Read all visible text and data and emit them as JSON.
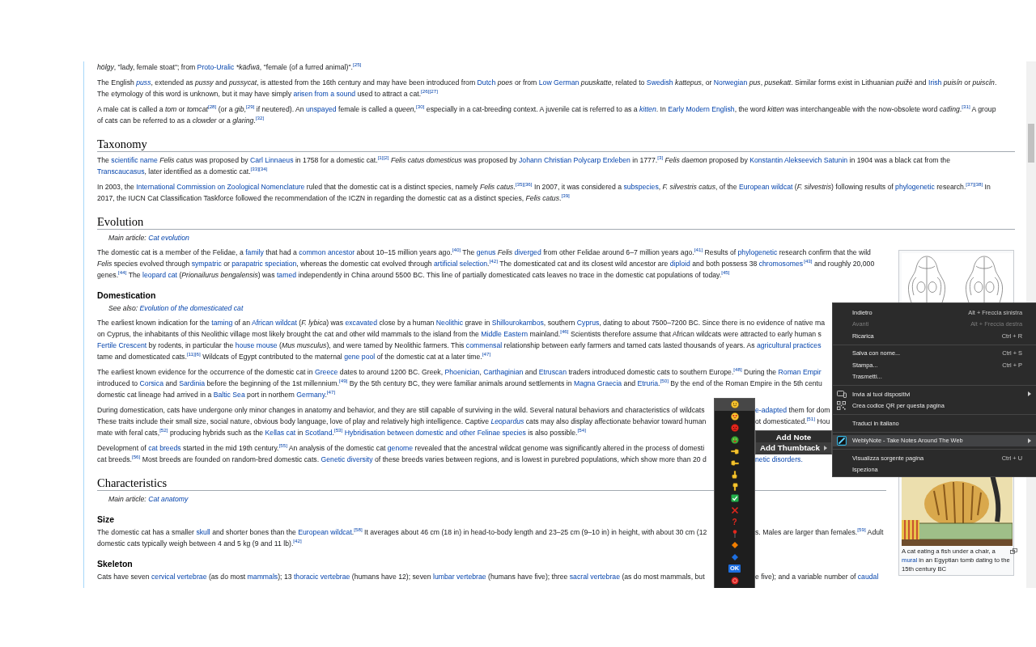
{
  "article": {
    "upper": [
      {
        "kind": "paragraph",
        "lines": [
          {
            "runs": [
              "*hölgy*, \"lady, female stoat\"; from ",
              {
                "link": "Proto-Uralic"
              },
              {
                "italic_text": " *käďwä"
              },
              ", \"female (of a furred animal)\".",
              {
                "ref": "[25]"
              }
            ]
          }
        ]
      },
      {
        "kind": "paragraph",
        "lines": [
          {
            "runs": [
              "The English ",
              {
                "link": "puss",
                "italic": true
              },
              ", extended as *pussy* and *pussycat*, is attested from the 16th century and may have been introduced from ",
              {
                "link": "Dutch"
              },
              " *poes* or from ",
              {
                "link": "Low German"
              },
              " *puuskatte*, related to ",
              {
                "link": "Swedish"
              },
              " *kattepus*, or ",
              {
                "link": "Norwegian"
              },
              " *pus*, *pusekatt*. Similar forms exist in Lithuanian *puižė* and ",
              {
                "link": "Irish"
              },
              " *puisín* or *puiscín*."
            ]
          },
          {
            "runs": [
              "The etymology of this word is unknown, but it may have simply ",
              {
                "link": "arisen from a sound"
              },
              " used to attract a cat.",
              {
                "ref": "[26][27]"
              }
            ]
          }
        ]
      },
      {
        "kind": "paragraph",
        "lines": [
          {
            "runs": [
              "A male cat is called a *tom* or *tomcat*",
              {
                "ref": "[28]"
              },
              " (or a *gib*,",
              {
                "ref": "[29]"
              },
              " if neutered). An ",
              {
                "link": "unspayed"
              },
              " female is called a *queen*,",
              {
                "ref": "[30]"
              },
              " especially in a cat-breeding context. A juvenile cat is referred to as a ",
              {
                "link": "kitten",
                "italic": true
              },
              ". In ",
              {
                "link": "Early Modern English"
              },
              ", the word *kitten* was interchangeable with the now-obsolete word *catling*.",
              {
                "ref": "[31]"
              },
              " A group"
            ]
          },
          {
            "runs": [
              "of cats can be referred to as a *clowder* or a *glaring*.",
              {
                "ref": "[32]"
              }
            ]
          }
        ]
      },
      {
        "kind": "heading",
        "text": "Taxonomy"
      },
      {
        "kind": "paragraph",
        "lines": [
          {
            "runs": [
              "The ",
              {
                "link": "scientific name"
              },
              " *Felis catus* was proposed by ",
              {
                "link": "Carl Linnaeus"
              },
              " in 1758 for a domestic cat.",
              {
                "ref": "[1][2]"
              },
              " *Felis catus domesticus* was proposed by ",
              {
                "link": "Johann Christian Polycarp Erxleben"
              },
              " in 1777.",
              {
                "ref": "[3]"
              },
              " *Felis daemon* proposed by ",
              {
                "link": "Konstantin Alekseevich Satunin"
              },
              " in 1904 was a black cat from the"
            ]
          },
          {
            "runs": [
              {
                "link": "Transcaucasus"
              },
              ", later identified as a domestic cat.",
              {
                "ref": "[33][34]"
              }
            ]
          }
        ]
      },
      {
        "kind": "paragraph",
        "lines": [
          {
            "runs": [
              "In 2003, the ",
              {
                "link": "International Commission on Zoological Nomenclature"
              },
              " ruled that the domestic cat is a distinct species, namely *Felis catus*.",
              {
                "ref": "[35][36]"
              },
              " In 2007, it was considered a ",
              {
                "link": "subspecies"
              },
              ", *F. silvestris catus*, of the ",
              {
                "link": "European wildcat"
              },
              " (*F. silvestris*) following results of ",
              {
                "link": "phylogenetic"
              },
              " research.",
              {
                "ref": "[37][38]"
              },
              " In"
            ]
          },
          {
            "runs": [
              "2017, the IUCN Cat Classification Taskforce followed the recommendation of the ICZN in regarding the domestic cat as a distinct species, *Felis catus*.",
              {
                "ref": "[39]"
              }
            ]
          }
        ]
      },
      {
        "kind": "heading",
        "text": "Evolution"
      },
      {
        "kind": "hatnote",
        "runs": [
          "Main article: ",
          {
            "link": "Cat evolution"
          }
        ]
      }
    ],
    "lower": {
      "blocks": [
        {
          "kind": "paragraph",
          "lines": [
            {
              "runs": [
                "The domestic cat is a member of the Felidae, a ",
                {
                  "link": "family"
                },
                " that had a ",
                {
                  "link": "common ancestor"
                },
                " about 10–15 million years ago.",
                {
                  "ref": "[40]"
                },
                " The ",
                {
                  "link": "genus"
                },
                " *Felis* ",
                {
                  "link": "diverged"
                },
                " from other Felidae around 6–7 million years ago.",
                {
                  "ref": "[41]"
                },
                " Results of ",
                {
                  "link": "phylogenetic"
                },
                " research confirm that the wild"
              ]
            },
            {
              "runs": [
                "*Felis* species evolved through ",
                {
                  "link": "sympatric"
                },
                " or ",
                {
                  "link": "parapatric speciation"
                },
                ", whereas the domestic cat evolved through ",
                {
                  "link": "artificial selection"
                },
                ".",
                {
                  "ref": "[42]"
                },
                " The domesticated cat and its closest wild ancestor are ",
                {
                  "link": "diploid"
                },
                " and both possess 38 ",
                {
                  "link": "chromosomes"
                },
                {
                  "ref": "[43]"
                },
                " and roughly 20,000"
              ]
            },
            {
              "runs": [
                "genes.",
                {
                  "ref": "[44]"
                },
                " The ",
                {
                  "link": "leopard cat"
                },
                " (*Prionailurus bengalensis*) was ",
                {
                  "link": "tamed"
                },
                " independently in China around 5500 BC. This line of partially domesticated cats leaves no trace in the domestic cat populations of today.",
                {
                  "ref": "[45]"
                }
              ]
            }
          ]
        },
        {
          "kind": "subheading",
          "text": "Domestication"
        },
        {
          "kind": "hatnote",
          "runs": [
            "See also: ",
            {
              "link": "Evolution of the domesticated cat"
            }
          ]
        },
        {
          "kind": "paragraph",
          "lines": [
            {
              "runs": [
                "The earliest known indication for the ",
                {
                  "link": "taming"
                },
                " of an ",
                {
                  "link": "African wildcat"
                },
                " (*F. lybica*) was ",
                {
                  "link": "excavated"
                },
                " close by a human ",
                {
                  "link": "Neolithic"
                },
                " grave in ",
                {
                  "link": "Shillourokambos"
                },
                ", southern ",
                {
                  "link": "Cyprus"
                },
                ", dating to about 7500–7200 BC. Since there is no evidence of native ma"
              ]
            },
            {
              "runs": [
                "on Cyprus, the inhabitants of this Neolithic village most likely brought the cat and other wild mammals to the island from the ",
                {
                  "link": "Middle Eastern"
                },
                " mainland.",
                {
                  "ref": "[46]"
                },
                " Scientists therefore assume that African wildcats were attracted to early human s"
              ]
            },
            {
              "runs": [
                {
                  "link": "Fertile Crescent"
                },
                " by rodents, in particular the ",
                {
                  "link": "house mouse"
                },
                " (*Mus musculus*), and were tamed by Neolithic farmers. This ",
                {
                  "link": "commensal"
                },
                " relationship between early farmers and tamed cats lasted thousands of years. As ",
                {
                  "link": "agricultural practices"
                }
              ]
            },
            {
              "runs": [
                "tame and domesticated cats.",
                {
                  "ref": "[11][6]"
                },
                " Wildcats of Egypt contributed to the maternal ",
                {
                  "link": "gene pool"
                },
                " of the domestic cat at a later time.",
                {
                  "ref": "[47]"
                }
              ]
            }
          ]
        },
        {
          "kind": "paragraph",
          "lines": [
            {
              "runs": [
                "The earliest known evidence for the occurrence of the domestic cat in ",
                {
                  "link": "Greece"
                },
                " dates to around 1200 BC. Greek, ",
                {
                  "link": "Phoenician"
                },
                ", ",
                {
                  "link": "Carthaginian"
                },
                " and ",
                {
                  "link": "Etruscan"
                },
                " traders introduced domestic cats to southern Europe.",
                {
                  "ref": "[48]"
                },
                " During the ",
                {
                  "link": "Roman Empir"
                }
              ]
            },
            {
              "runs": [
                "introduced to ",
                {
                  "link": "Corsica"
                },
                " and ",
                {
                  "link": "Sardinia"
                },
                " before the beginning of the 1st millennium.",
                {
                  "ref": "[49]"
                },
                " By the 5th century BC, they were familiar animals around settlements in ",
                {
                  "link": "Magna Graecia"
                },
                " and ",
                {
                  "link": "Etruria"
                },
                ".",
                {
                  "ref": "[50]"
                },
                " By the end of the Roman Empire in the 5th centu"
              ]
            },
            {
              "runs": [
                "domestic cat lineage had arrived in a ",
                {
                  "link": "Baltic Sea"
                },
                " port in northern ",
                {
                  "link": "Germany"
                },
                ".",
                {
                  "ref": "[47]"
                }
              ]
            }
          ]
        },
        {
          "kind": "paragraph",
          "lines": [
            {
              "runs": [
                "During domestication, cats have undergone only minor changes in anatomy and behavior, and they are still capable of surviving in the wild. Several natural behaviors and characteristics of wildcats"
              ],
              "after_panel": [
                {
                  "link": "e-adapted"
                },
                " them for dom"
              ]
            },
            {
              "runs": [
                "These traits include their small size, social nature, obvious body language, love of play and relatively high intelligence. Captive ",
                {
                  "link": "Leopardus",
                  "italic": true
                },
                " cats may also display affectionate behavior toward human"
              ],
              "after_panel": [
                "ot domesticated.",
                {
                  "ref": "[51]"
                },
                " Hou"
              ]
            },
            {
              "runs": [
                "mate with feral cats,",
                {
                  "ref": "[52]"
                },
                " producing hybrids such as the ",
                {
                  "link": "Kellas cat"
                },
                " in ",
                {
                  "link": "Scotland"
                },
                ".",
                {
                  "ref": "[53]"
                },
                {
                  "link": " Hybridisation between domestic and other Felinae species"
                },
                " is also possible.",
                {
                  "ref": "[54]"
                }
              ]
            }
          ]
        },
        {
          "kind": "paragraph",
          "lines": [
            {
              "runs": [
                "Development of ",
                {
                  "link": "cat breeds"
                },
                " started in the mid 19th century.",
                {
                  "ref": "[55]"
                },
                " An analysis of the domestic cat ",
                {
                  "link": "genome"
                },
                " revealed that the ancestral wildcat genome was significantly altered in the process of domesti"
              ]
            },
            {
              "runs": [
                "cat breeds.",
                {
                  "ref": "[56]"
                },
                " Most breeds are founded on random-bred domestic cats. ",
                {
                  "link": "Genetic diversity"
                },
                " of these breeds varies between regions, and is lowest in purebred populations, which show more than 20 d"
              ],
              "after_panel": [
                {
                  "link": "netic disorders."
                }
              ]
            }
          ]
        },
        {
          "kind": "heading",
          "text": "Characteristics"
        },
        {
          "kind": "hatnote",
          "runs": [
            "Main article: ",
            {
              "link": "Cat anatomy"
            }
          ]
        },
        {
          "kind": "subheading",
          "text": "Size"
        },
        {
          "kind": "paragraph",
          "lines": [
            {
              "runs": [
                "The domestic cat has a smaller ",
                {
                  "link": "skull"
                },
                " and shorter bones than the ",
                {
                  "link": "European wildcat"
                },
                ".",
                {
                  "ref": "[58]"
                },
                " It averages about 46 cm (18 in) in head-to-body length and 23–25 cm (9–10 in) in height, with about 30 cm (12"
              ],
              "after_panel": [
                "s. Males are larger than females.",
                {
                  "ref": "[59]"
                },
                " Adult"
              ]
            },
            {
              "runs": [
                "domestic cats typically weigh between 4 and 5 kg (9 and 11 lb).",
                {
                  "ref": "[42]"
                }
              ]
            }
          ]
        },
        {
          "kind": "subheading",
          "text": "Skeleton"
        },
        {
          "kind": "paragraph",
          "lines": [
            {
              "runs": [
                "Cats have seven ",
                {
                  "link": "cervical vertebrae"
                },
                " (as do most ",
                {
                  "link": "mammals"
                },
                "); 13 ",
                {
                  "link": "thoracic vertebrae"
                },
                " (humans have 12); seven ",
                {
                  "link": "lumbar vertebrae"
                },
                " (humans have five); three ",
                {
                  "link": "sacral vertebrae"
                },
                " (as do most mammals, but"
              ],
              "after_panel": [
                "e five); and a variable number of ",
                {
                  "link": "caudal"
                }
              ]
            }
          ]
        }
      ],
      "figures": [
        {
          "kind": "skulls"
        },
        {
          "kind": "mural",
          "caption": [
            {
              "runs": [
                "A cat eating a fish under a chair, a"
              ]
            },
            {
              "runs": [
                {
                  "link": "mural"
                },
                " in an Egyptian tomb dating to the"
              ]
            },
            {
              "runs": [
                "15th century BC"
              ]
            }
          ]
        }
      ]
    }
  },
  "context_menu": {
    "groups": [
      [
        {
          "kind": "command",
          "label": "Indietro",
          "shortcut": "Alt + Freccia sinistra",
          "disabled": false,
          "selected": false,
          "submenu": false
        },
        {
          "kind": "command",
          "label": "Avanti",
          "shortcut": "Alt + Freccia destra",
          "disabled": true,
          "selected": false,
          "submenu": false
        },
        {
          "kind": "command",
          "label": "Ricarica",
          "shortcut": "Ctrl + R",
          "disabled": false,
          "selected": false,
          "submenu": false
        }
      ],
      [
        {
          "kind": "command",
          "label": "Salva con nome...",
          "shortcut": "Ctrl + S",
          "disabled": false,
          "selected": false,
          "submenu": false
        },
        {
          "kind": "command",
          "label": "Stampa...",
          "shortcut": "Ctrl + P",
          "disabled": false,
          "selected": false,
          "submenu": false
        },
        {
          "kind": "command",
          "label": "Trasmetti...",
          "disabled": false,
          "selected": false,
          "submenu": false
        }
      ],
      [
        {
          "kind": "devices",
          "label": "Invia ai tuoi dispositivi",
          "disabled": false,
          "selected": false,
          "submenu": true
        },
        {
          "kind": "qr-code",
          "label": "Crea codice QR per questa pagina",
          "disabled": false,
          "selected": false,
          "submenu": false
        }
      ],
      [
        {
          "kind": "command",
          "label": "Traduci in italiano",
          "disabled": false,
          "selected": false,
          "submenu": false
        }
      ],
      [
        {
          "kind": "extension",
          "label": "WeblyNote - Take Notes Around The Web",
          "disabled": false,
          "selected": true,
          "submenu": true
        }
      ],
      [
        {
          "kind": "command",
          "label": "Visualizza sorgente pagina",
          "shortcut": "Ctrl + U",
          "disabled": false,
          "selected": false,
          "submenu": false
        },
        {
          "kind": "command",
          "label": "Ispeziona",
          "disabled": false,
          "selected": false,
          "submenu": false
        }
      ]
    ]
  },
  "note_submenu": {
    "items": [
      {
        "label": "Add Note",
        "selected": false,
        "submenu": false
      },
      {
        "label": "Add Thumbtack",
        "selected": true,
        "submenu": true
      }
    ]
  },
  "thumbtack_picker": {
    "items": [
      {
        "kind": "smiley",
        "selected": true
      },
      {
        "kind": "heart-eyes",
        "selected": false
      },
      {
        "kind": "angry",
        "selected": false
      },
      {
        "kind": "sick",
        "selected": false
      },
      {
        "kind": "point-left",
        "selected": false
      },
      {
        "kind": "point-right",
        "selected": false
      },
      {
        "kind": "point-up",
        "selected": false
      },
      {
        "kind": "point-down",
        "selected": false
      },
      {
        "kind": "check",
        "selected": false
      },
      {
        "kind": "cross",
        "selected": false
      },
      {
        "kind": "question",
        "label": "?",
        "selected": false
      },
      {
        "kind": "pin",
        "selected": false
      },
      {
        "kind": "diamond",
        "color": "#f07d00",
        "selected": false
      },
      {
        "kind": "diamond",
        "color": "#1e6fe0",
        "selected": false
      },
      {
        "kind": "badge",
        "label": "OK",
        "selected": false
      },
      {
        "kind": "round",
        "selected": false
      }
    ]
  }
}
